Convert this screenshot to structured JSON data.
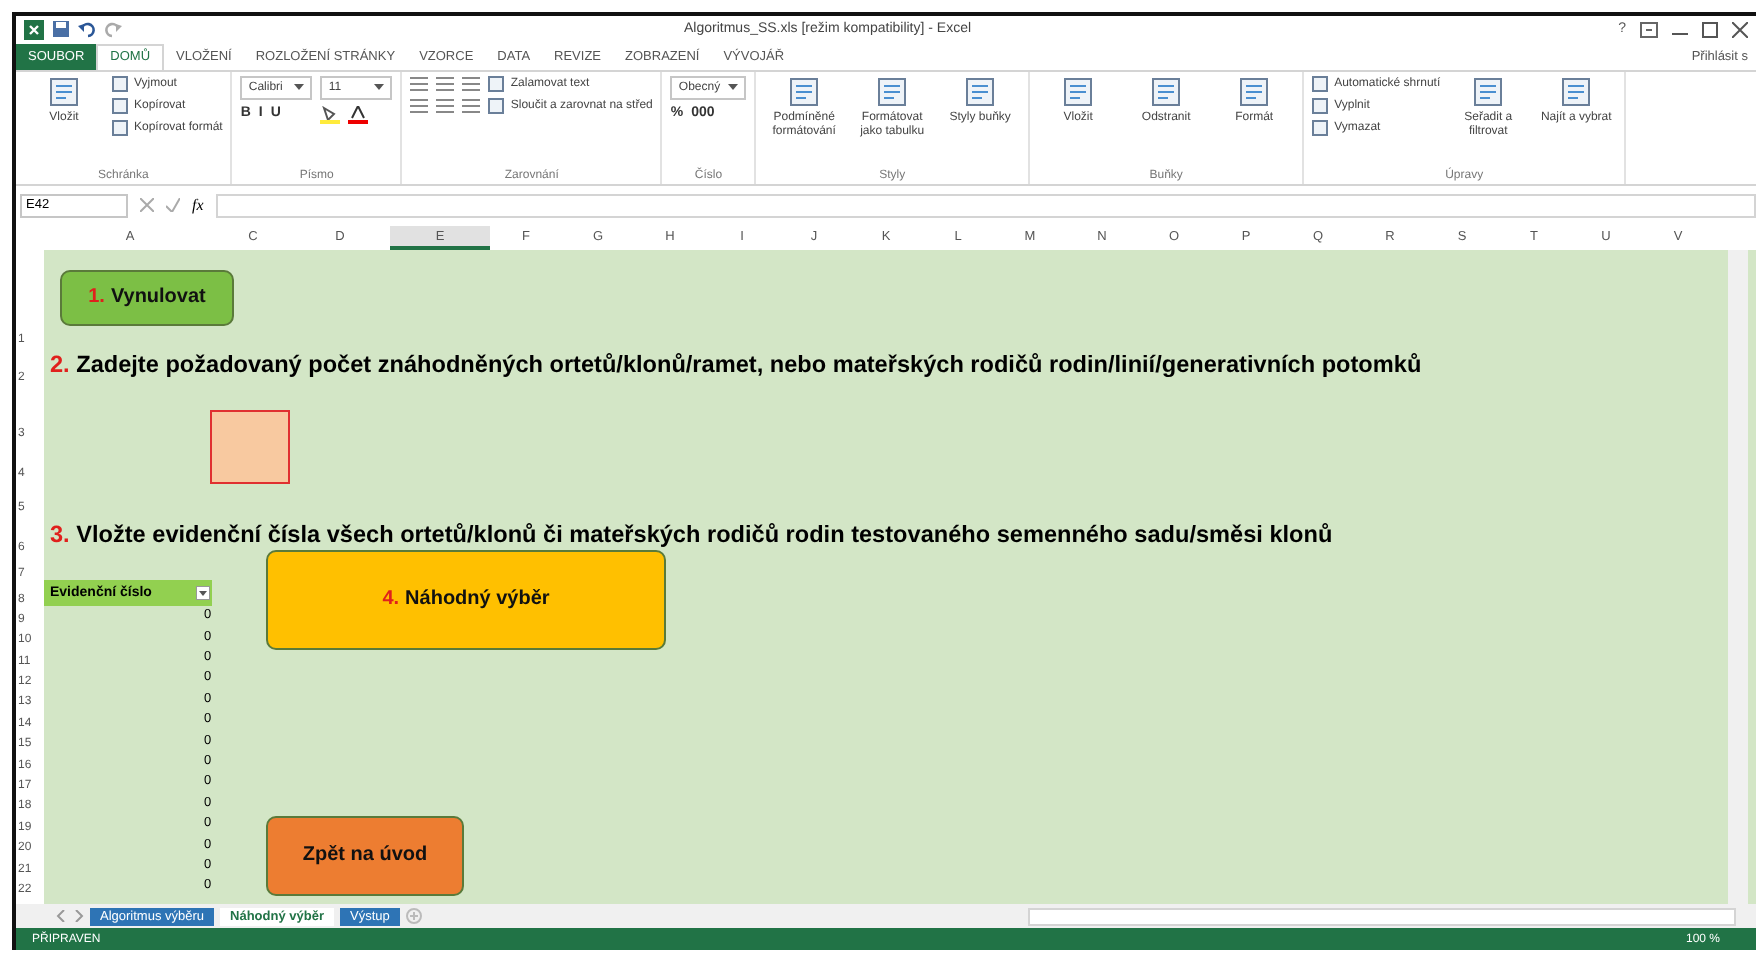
{
  "window": {
    "title": "Algoritmus_SS.xls  [režim kompatibility] - Excel",
    "help": "?",
    "sign_in": "Přihlásit s"
  },
  "ribbon_tabs": [
    {
      "label": "SOUBOR",
      "kind": "file",
      "selected": false
    },
    {
      "label": "DOMŮ",
      "kind": "tab",
      "selected": true
    },
    {
      "label": "VLOŽENÍ",
      "kind": "tab",
      "selected": false
    },
    {
      "label": "ROZLOŽENÍ STRÁNKY",
      "kind": "tab",
      "selected": false
    },
    {
      "label": "VZORCE",
      "kind": "tab",
      "selected": false
    },
    {
      "label": "DATA",
      "kind": "tab",
      "selected": false
    },
    {
      "label": "REVIZE",
      "kind": "tab",
      "selected": false
    },
    {
      "label": "ZOBRAZENÍ",
      "kind": "tab",
      "selected": false
    },
    {
      "label": "VÝVOJÁŘ",
      "kind": "tab",
      "selected": false
    }
  ],
  "ribbon_groups": [
    {
      "label": "Schránka",
      "columns": [
        {
          "kind": "large",
          "label": "Vložit"
        },
        {
          "kind": "stack",
          "items": [
            {
              "kind": "small",
              "label": "Vyjmout"
            },
            {
              "kind": "small",
              "label": "Kopírovat"
            },
            {
              "kind": "small",
              "label": "Kopírovat formát"
            }
          ]
        }
      ]
    },
    {
      "label": "Písmo",
      "columns": [
        {
          "kind": "stack",
          "items": [
            {
              "kind": "combo",
              "value": "Calibri"
            },
            {
              "kind": "glyphs",
              "glyphs": [
                "B",
                "I",
                "U"
              ]
            }
          ]
        },
        {
          "kind": "stack",
          "items": [
            {
              "kind": "combo",
              "value": "11"
            },
            {
              "kind": "colors"
            }
          ]
        }
      ]
    },
    {
      "label": "Zarovnání",
      "columns": [
        {
          "kind": "stack",
          "items": [
            {
              "kind": "align"
            },
            {
              "kind": "align"
            }
          ]
        },
        {
          "kind": "stack",
          "items": [
            {
              "kind": "small",
              "label": "Zalamovat text"
            },
            {
              "kind": "small",
              "label": "Sloučit a zarovnat na střed"
            }
          ]
        }
      ]
    },
    {
      "label": "Číslo",
      "columns": [
        {
          "kind": "stack",
          "items": [
            {
              "kind": "combo",
              "value": "Obecný"
            },
            {
              "kind": "glyphs",
              "glyphs": [
                "%",
                "000"
              ]
            }
          ]
        }
      ]
    },
    {
      "label": "Styly",
      "columns": [
        {
          "kind": "large",
          "label": "Podmíněné formátování"
        },
        {
          "kind": "large",
          "label": "Formátovat jako tabulku"
        },
        {
          "kind": "large",
          "label": "Styly buňky"
        }
      ]
    },
    {
      "label": "Buňky",
      "columns": [
        {
          "kind": "large",
          "label": "Vložit"
        },
        {
          "kind": "large",
          "label": "Odstranit"
        },
        {
          "kind": "large",
          "label": "Formát"
        }
      ]
    },
    {
      "label": "Úpravy",
      "columns": [
        {
          "kind": "stack",
          "items": [
            {
              "kind": "small",
              "label": "Automatické shrnutí"
            },
            {
              "kind": "small",
              "label": "Vyplnit"
            },
            {
              "kind": "small",
              "label": "Vymazat"
            }
          ]
        },
        {
          "kind": "large",
          "label": "Seřadit a filtrovat"
        },
        {
          "kind": "large",
          "label": "Najít a vybrat"
        }
      ]
    }
  ],
  "formula_bar": {
    "name_box": "E42",
    "function_label": "fx"
  },
  "columns": [
    {
      "label": "A",
      "selected": false
    },
    {
      "label": "C",
      "selected": false
    },
    {
      "label": "D",
      "selected": false
    },
    {
      "label": "E",
      "selected": true
    },
    {
      "label": "F",
      "selected": false
    },
    {
      "label": "G",
      "selected": false
    },
    {
      "label": "H",
      "selected": false
    },
    {
      "label": "I",
      "selected": false
    },
    {
      "label": "J",
      "selected": false
    },
    {
      "label": "K",
      "selected": false
    },
    {
      "label": "L",
      "selected": false
    },
    {
      "label": "M",
      "selected": false
    },
    {
      "label": "N",
      "selected": false
    },
    {
      "label": "O",
      "selected": false
    },
    {
      "label": "P",
      "selected": false
    },
    {
      "label": "Q",
      "selected": false
    },
    {
      "label": "R",
      "selected": false
    },
    {
      "label": "S",
      "selected": false
    },
    {
      "label": "T",
      "selected": false
    },
    {
      "label": "U",
      "selected": false
    },
    {
      "label": "V",
      "selected": false
    }
  ],
  "row_numbers": [
    "1",
    "2",
    "3",
    "4",
    "5",
    "6",
    "7",
    "8",
    "9",
    "10",
    "11",
    "12",
    "13",
    "14",
    "15",
    "16",
    "17",
    "18",
    "19",
    "20",
    "21",
    "22"
  ],
  "instructions": [
    {
      "number": "2.",
      "text": "Zadejte požadovaný počet znáhodněných ortetů/klonů/ramet, nebo mateřských rodičů rodin/linií/generativních potomků"
    },
    {
      "number": "3.",
      "text": "Vložte evidenční čísla všech ortetů/klonů či mateřských rodičů rodin testovaného semenného sadu/směsi klonů"
    }
  ],
  "shapes": [
    {
      "number": "1.",
      "label": "Vynulovat",
      "color": "#7cbf45"
    },
    {
      "number": "4.",
      "label": "Náhodný výběr",
      "color": "#ffc000"
    },
    {
      "label": "Zpět na úvod",
      "color": "#ed7d31"
    }
  ],
  "table": {
    "header": "Evidenční číslo",
    "values": [
      "0",
      "0",
      "0",
      "0",
      "0",
      "0",
      "0",
      "0",
      "0",
      "0",
      "0",
      "0",
      "0",
      "0"
    ]
  },
  "sheet_tabs": [
    {
      "label": "Algoritmus výběru",
      "selected": false
    },
    {
      "label": "Náhodný výběr",
      "selected": true
    },
    {
      "label": "Výstup",
      "selected": false
    }
  ],
  "status_bar": {
    "text": "PŘIPRAVEN",
    "zoom": "100 %"
  }
}
